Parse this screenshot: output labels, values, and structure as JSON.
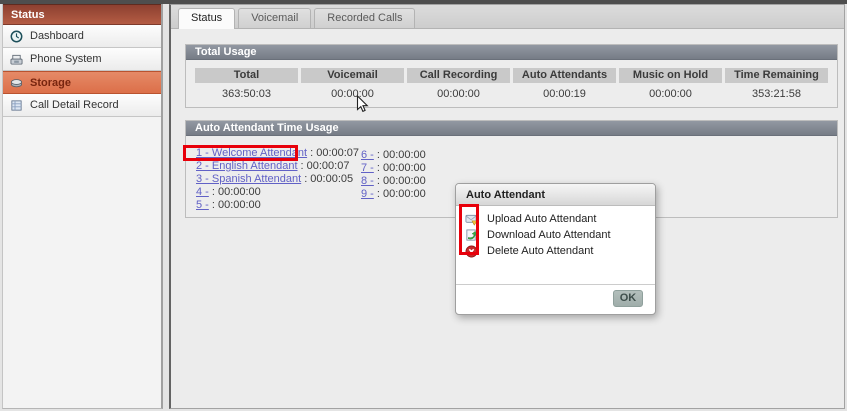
{
  "sidebar": {
    "header": "Status",
    "items": [
      {
        "label": "Dashboard",
        "icon": "clock-icon",
        "selected": false
      },
      {
        "label": "Phone System",
        "icon": "phone-icon",
        "selected": false
      },
      {
        "label": "Storage",
        "icon": "disk-icon",
        "selected": true
      },
      {
        "label": "Call Detail Record",
        "icon": "table-icon",
        "selected": false
      }
    ]
  },
  "tabs": [
    {
      "label": "Status",
      "active": true
    },
    {
      "label": "Voicemail",
      "active": false
    },
    {
      "label": "Recorded Calls",
      "active": false
    }
  ],
  "total_usage": {
    "title": "Total Usage",
    "columns": [
      "Total",
      "Voicemail",
      "Call Recording",
      "Auto Attendants",
      "Music on Hold",
      "Time Remaining"
    ],
    "values": [
      "363:50:03",
      "00:00:00",
      "00:00:00",
      "00:00:19",
      "00:00:00",
      "353:21:58"
    ]
  },
  "attendant_usage": {
    "title": "Auto Attendant Time Usage",
    "column1": [
      {
        "link": "1 - Welcome Attendant",
        "time_text": ": 00:00:07",
        "highlighted": true
      },
      {
        "link": "2 - English Attendant",
        "time_text": ": 00:00:07",
        "highlighted": false
      },
      {
        "link": "3 - Spanish Attendant",
        "time_text": ": 00:00:05",
        "highlighted": false
      },
      {
        "link": "4 -",
        "time_text": ": 00:00:00",
        "highlighted": false
      },
      {
        "link": "5 -",
        "time_text": ": 00:00:00",
        "highlighted": false
      }
    ],
    "column2": [
      {
        "link": "6 -",
        "time_text": ": 00:00:00"
      },
      {
        "link": "7 -",
        "time_text": ": 00:00:00"
      },
      {
        "link": "8 -",
        "time_text": ": 00:00:00"
      },
      {
        "link": "9 -",
        "time_text": ": 00:00:00"
      }
    ]
  },
  "dialog": {
    "title": "Auto Attendant",
    "items": [
      {
        "label": "Upload Auto Attendant",
        "icon": "upload-icon"
      },
      {
        "label": "Download Auto Attendant",
        "icon": "download-icon"
      },
      {
        "label": "Delete Auto Attendant",
        "icon": "delete-icon"
      }
    ],
    "ok_label": "OK"
  },
  "colors": {
    "sidebar_header_red": "#9c4736",
    "selected_item_orange": "#dd7450",
    "section_header_gray": "#858b95",
    "link_purple": "#6161c6",
    "annotation_red": "#e8000b",
    "ok_button_gray_green": "#a9b6b3"
  }
}
